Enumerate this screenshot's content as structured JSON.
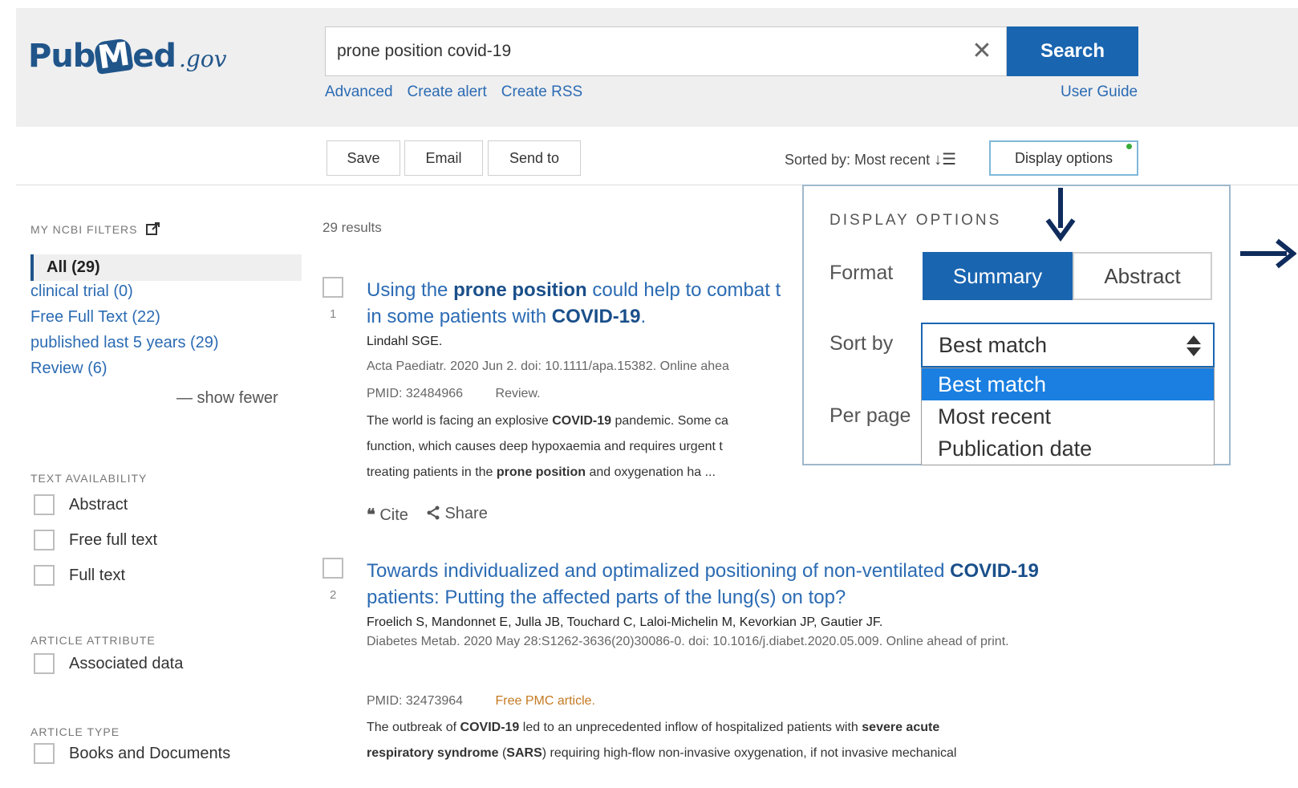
{
  "header": {
    "logo_pub": "Pub",
    "logo_m": "M",
    "logo_ed": "ed",
    "logo_gov": ".gov",
    "search_value": "prone position covid-19",
    "clear_icon": "✕",
    "search_label": "Search",
    "links": [
      "Advanced",
      "Create alert",
      "Create RSS"
    ],
    "user_guide": "User Guide"
  },
  "toolbar": {
    "save": "Save",
    "email": "Email",
    "send_to": "Send to",
    "sorted_by": "Sorted by: Most recent",
    "sort_icon": "↓☰",
    "display_options": "Display options"
  },
  "sidebar": {
    "my_ncbi_filters": "MY NCBI FILTERS",
    "filter_all": "All (29)",
    "filters": [
      "clinical trial (0)",
      "Free Full Text (22)",
      "published last 5 years (29)",
      "Review (6)"
    ],
    "show_fewer": "— show fewer",
    "text_availability": "TEXT AVAILABILITY",
    "text_options": [
      "Abstract",
      "Free full text",
      "Full text"
    ],
    "article_attribute": "ARTICLE ATTRIBUTE",
    "attribute_options": [
      "Associated data"
    ],
    "article_type": "ARTICLE TYPE",
    "type_options": [
      "Books and Documents"
    ]
  },
  "results": {
    "count": "29 results",
    "items": [
      {
        "num": "1",
        "title_pre": "Using the ",
        "title_b1": "prone position",
        "title_mid": " could help to combat t",
        "title_line2_pre": "in some patients with ",
        "title_b2": "COVID-19",
        "title_end": ".",
        "authors": "Lindahl SGE.",
        "citation": "Acta Paediatr. 2020 Jun 2. doi: 10.1111/apa.15382. Online ahea",
        "pmid": "PMID: 32484966",
        "tag": "Review.",
        "snippet_l1_pre": "The world is facing an explosive ",
        "snippet_l1_b": "COVID-19",
        "snippet_l1_post": " pandemic. Some ca",
        "snippet_l2": "function, which causes deep hypoxaemia and requires urgent t",
        "snippet_l3_pre": "treating patients in the ",
        "snippet_l3_b": "prone position",
        "snippet_l3_post": " and oxygenation ha ...",
        "cite": "Cite",
        "share": "Share"
      },
      {
        "num": "2",
        "title_l1_pre": "Towards individualized and optimalized positioning of non-ventilated ",
        "title_l1_b": "COVID-19",
        "title_l2": "patients: Putting the affected parts of the lung(s) on top?",
        "authors": "Froelich S, Mandonnet E, Julla JB, Touchard C, Laloi-Michelin M, Kevorkian JP, Gautier JF.",
        "citation": "Diabetes Metab. 2020 May 28:S1262-3636(20)30086-0. doi: 10.1016/j.diabet.2020.05.009. Online ahead of print.",
        "pmid": "PMID: 32473964",
        "tag": "Free PMC article.",
        "snippet_l1_pre": "The outbreak of ",
        "snippet_l1_b": "COVID-19",
        "snippet_l1_mid": " led to an unprecedented inflow of hospitalized patients with ",
        "snippet_l1_b2": "severe acute",
        "snippet_l2_b": "respiratory syndrome",
        "snippet_l2_mid": " (",
        "snippet_l2_b2": "SARS",
        "snippet_l2_post": ") requiring high-flow non-invasive oxygenation, if not invasive mechanical"
      }
    ]
  },
  "display_popup": {
    "title": "DISPLAY OPTIONS",
    "format_label": "Format",
    "summary": "Summary",
    "abstract": "Abstract",
    "sort_label": "Sort by",
    "sort_value": "Best match",
    "per_page_label": "Per page",
    "options": [
      "Best match",
      "Most recent",
      "Publication date"
    ]
  },
  "colors": {
    "brand_blue": "#1a65b0",
    "link_blue": "#2b6bb3",
    "arrow_navy": "#0f2c5c",
    "free_orange": "#c47a22",
    "selected_option": "#1a7fe0"
  }
}
